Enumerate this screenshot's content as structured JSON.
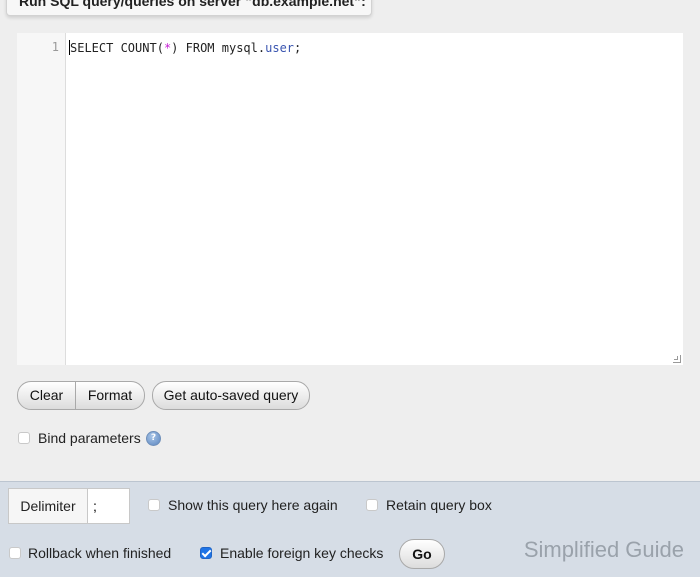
{
  "panel": {
    "title": "Run SQL query/queries on server “db.example.net”:",
    "help_icon": "help-icon"
  },
  "editor": {
    "line_number": "1",
    "code": {
      "kw1": "SELECT COUNT",
      "paren_open": "(",
      "star": "*",
      "paren_close": ")",
      "kw2": " FROM mysql",
      "dot": ".",
      "table": "user",
      "semicolon": ";"
    }
  },
  "buttons": {
    "clear": "Clear",
    "format": "Format",
    "autosave": "Get auto-saved query",
    "go": "Go"
  },
  "bind_parameters": {
    "label": "Bind parameters",
    "checked": false
  },
  "options": {
    "delimiter_label": "Delimiter",
    "delimiter_value": ";",
    "show_query_again": {
      "label": "Show this query here again",
      "checked": false
    },
    "retain_query_box": {
      "label": "Retain query box",
      "checked": false
    },
    "rollback": {
      "label": "Rollback when finished",
      "checked": false
    },
    "foreign_key_checks": {
      "label": "Enable foreign key checks",
      "checked": true
    }
  },
  "watermark": "Simplified Guide",
  "colors": {
    "accent": "#1f74e6",
    "operator": "#c71fd6",
    "property": "#3a55b0",
    "bottom_bar": "#d6dde6"
  }
}
